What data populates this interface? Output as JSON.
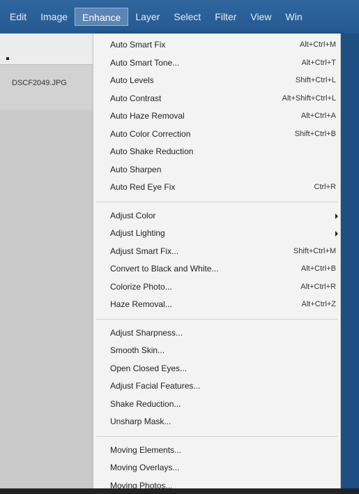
{
  "menubar": {
    "items": [
      "Edit",
      "Image",
      "Enhance",
      "Layer",
      "Select",
      "Filter",
      "View",
      "Win"
    ]
  },
  "left_panel": {
    "filename": "DSCF2049.JPG"
  },
  "enhance_menu": {
    "group1": [
      {
        "label": "Auto Smart Fix",
        "shortcut": "Alt+Ctrl+M"
      },
      {
        "label": "Auto Smart Tone...",
        "shortcut": "Alt+Ctrl+T"
      },
      {
        "label": "Auto Levels",
        "shortcut": "Shift+Ctrl+L"
      },
      {
        "label": "Auto Contrast",
        "shortcut": "Alt+Shift+Ctrl+L"
      },
      {
        "label": "Auto Haze Removal",
        "shortcut": "Alt+Ctrl+A"
      },
      {
        "label": "Auto Color Correction",
        "shortcut": "Shift+Ctrl+B"
      },
      {
        "label": "Auto Shake Reduction",
        "shortcut": ""
      },
      {
        "label": "Auto Sharpen",
        "shortcut": ""
      },
      {
        "label": "Auto Red Eye Fix",
        "shortcut": "Ctrl+R"
      }
    ],
    "group2": [
      {
        "label": "Adjust Color",
        "shortcut": ""
      },
      {
        "label": "Adjust Lighting",
        "shortcut": ""
      },
      {
        "label": "Adjust Smart Fix...",
        "shortcut": "Shift+Ctrl+M"
      },
      {
        "label": "Convert to Black and White...",
        "shortcut": "Alt+Ctrl+B"
      },
      {
        "label": "Colorize Photo...",
        "shortcut": "Alt+Ctrl+R"
      },
      {
        "label": "Haze Removal...",
        "shortcut": "Alt+Ctrl+Z"
      }
    ],
    "group3": [
      {
        "label": "Adjust Sharpness...",
        "shortcut": ""
      },
      {
        "label": "Smooth Skin...",
        "shortcut": ""
      },
      {
        "label": "Open Closed Eyes...",
        "shortcut": ""
      },
      {
        "label": "Adjust Facial Features...",
        "shortcut": ""
      },
      {
        "label": "Shake Reduction...",
        "shortcut": ""
      },
      {
        "label": "Unsharp Mask...",
        "shortcut": ""
      }
    ],
    "group4": [
      {
        "label": "Moving Elements...",
        "shortcut": ""
      },
      {
        "label": "Moving Overlays...",
        "shortcut": ""
      },
      {
        "label": "Moving Photos...",
        "shortcut": ""
      }
    ]
  }
}
